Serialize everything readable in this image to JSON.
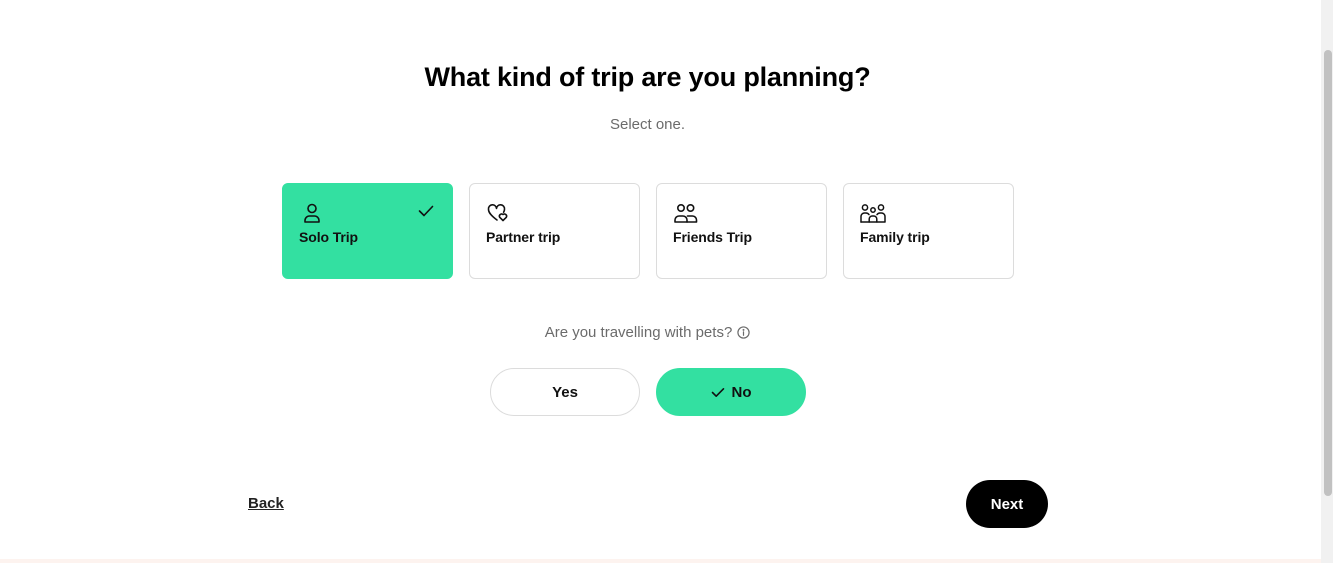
{
  "heading": {
    "title": "What kind of trip are you planning?",
    "subtitle": "Select one."
  },
  "trip_types": [
    {
      "label": "Solo Trip",
      "icon": "person-icon",
      "selected": true
    },
    {
      "label": "Partner trip",
      "icon": "heart-icon",
      "selected": false
    },
    {
      "label": "Friends Trip",
      "icon": "two-people-icon",
      "selected": false
    },
    {
      "label": "Family trip",
      "icon": "family-icon",
      "selected": false
    }
  ],
  "pets": {
    "question": "Are you travelling with pets?",
    "info_icon": "info-icon",
    "yes_label": "Yes",
    "no_label": "No",
    "selected": "No"
  },
  "footer": {
    "back_label": "Back",
    "next_label": "Next"
  },
  "colors": {
    "accent": "#33e0a1",
    "primary_button": "#000000",
    "muted_text": "#6b6b6b",
    "border": "#dcdcdc"
  }
}
